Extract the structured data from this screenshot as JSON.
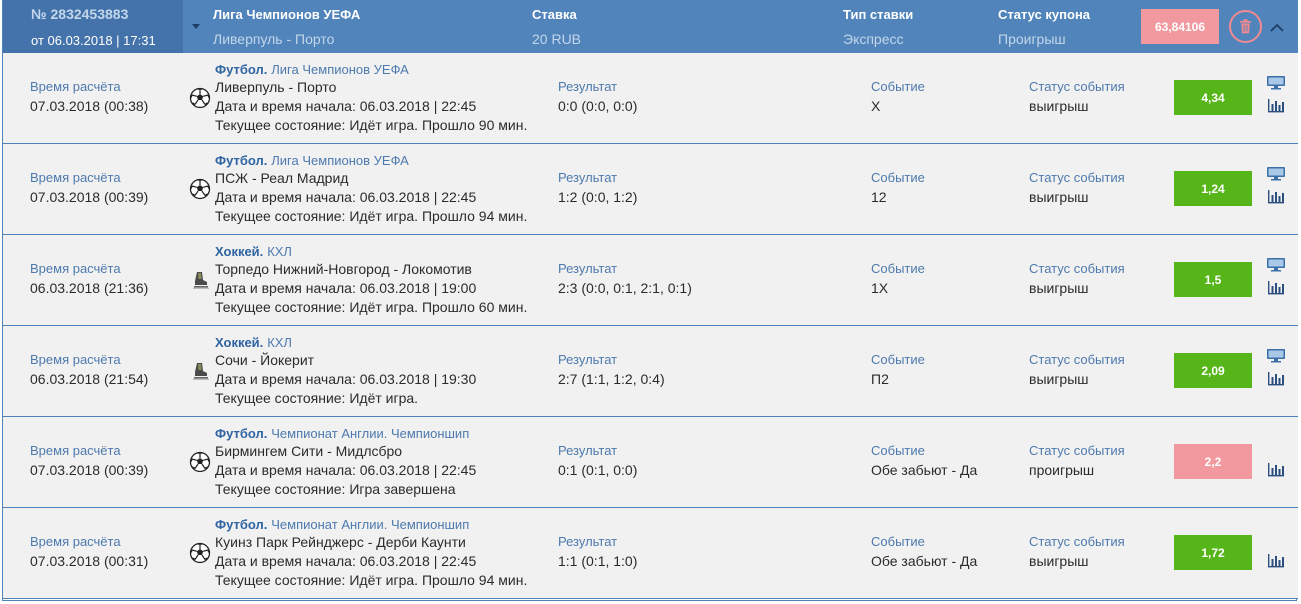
{
  "header": {
    "coupon_number": "№ 2832453883",
    "coupon_date": "от 06.03.2018 | 17:31",
    "tournament_label": "Лига Чемпионов УЕФА",
    "tournament_value": "Ливерпуль - Порто",
    "stake_label": "Ставка",
    "stake_value": "20 RUB",
    "bet_type_label": "Тип ставки",
    "bet_type_value": "Экспресс",
    "status_label": "Статус купона",
    "status_value": "Проигрыш",
    "total_odds": "63,84106",
    "colors": {
      "header_bg": "#5184bb",
      "badge_lose": "#f2999f",
      "badge_win": "#56b518"
    }
  },
  "labels": {
    "settle_time": "Время расчёта",
    "result": "Результат",
    "event": "Событие",
    "event_status": "Статус события",
    "start": "Дата и время начала:",
    "state": "Текущее состояние:"
  },
  "bets": [
    {
      "settle_time": "07.03.2018 (00:38)",
      "sport": "Футбол.",
      "league": "Лига Чемпионов УЕФА",
      "sport_icon": "soccer-ball-icon",
      "match": "Ливерпуль - Порто",
      "start": "06.03.2018 | 22:45",
      "state": "Идёт игра. Прошло 90 мин.",
      "result": "0:0 (0:0, 0:0)",
      "event": "X",
      "event_status": "выигрыш",
      "odds": "4,34",
      "odds_status": "win",
      "has_tv": true
    },
    {
      "settle_time": "07.03.2018 (00:39)",
      "sport": "Футбол.",
      "league": "Лига Чемпионов УЕФА",
      "sport_icon": "soccer-ball-icon",
      "match": "ПСЖ - Реал Мадрид",
      "start": "06.03.2018 | 22:45",
      "state": "Идёт игра. Прошло 94 мин.",
      "result": "1:2 (0:0, 1:2)",
      "event": "12",
      "event_status": "выигрыш",
      "odds": "1,24",
      "odds_status": "win",
      "has_tv": true
    },
    {
      "settle_time": "06.03.2018 (21:36)",
      "sport": "Хоккей.",
      "league": "КХЛ",
      "sport_icon": "hockey-skate-icon",
      "match": "Торпедо Нижний-Новгород - Локомотив",
      "start": "06.03.2018 | 19:00",
      "state": "Идёт игра. Прошло 60 мин.",
      "result": "2:3 (0:0, 0:1, 2:1, 0:1)",
      "event": "1X",
      "event_status": "выигрыш",
      "odds": "1,5",
      "odds_status": "win",
      "has_tv": true
    },
    {
      "settle_time": "06.03.2018 (21:54)",
      "sport": "Хоккей.",
      "league": "КХЛ",
      "sport_icon": "hockey-skate-icon",
      "match": "Сочи - Йокерит",
      "start": "06.03.2018 | 19:30",
      "state": "Идёт игра.",
      "result": "2:7 (1:1, 1:2, 0:4)",
      "event": "П2",
      "event_status": "выигрыш",
      "odds": "2,09",
      "odds_status": "win",
      "has_tv": true
    },
    {
      "settle_time": "07.03.2018 (00:39)",
      "sport": "Футбол.",
      "league": "Чемпионат Англии. Чемпионшип",
      "sport_icon": "soccer-ball-icon",
      "match": "Бирмингем Сити - Мидлсбро",
      "start": "06.03.2018 | 22:45",
      "state": "Игра завершена",
      "result": "0:1 (0:1, 0:0)",
      "event": "Обе забьют - Да",
      "event_status": "проигрыш",
      "odds": "2,2",
      "odds_status": "lose",
      "has_tv": false
    },
    {
      "settle_time": "07.03.2018 (00:31)",
      "sport": "Футбол.",
      "league": "Чемпионат Англии. Чемпионшип",
      "sport_icon": "soccer-ball-icon",
      "match": "Куинз Парк Рейнджерс - Дерби Каунти",
      "start": "06.03.2018 | 22:45",
      "state": "Идёт игра. Прошло 94 мин.",
      "result": "1:1 (0:1, 1:0)",
      "event": "Обе забьют - Да",
      "event_status": "выигрыш",
      "odds": "1,72",
      "odds_status": "win",
      "has_tv": false
    }
  ]
}
